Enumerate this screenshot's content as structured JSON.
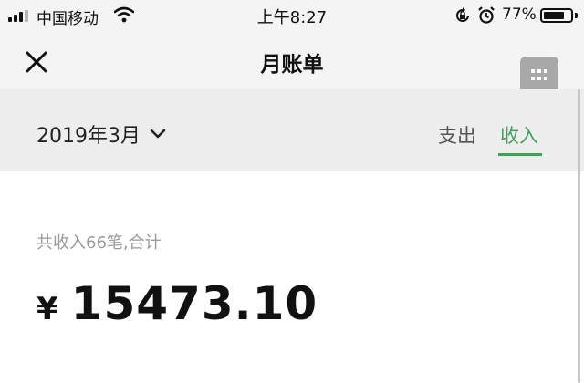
{
  "status_bar": {
    "carrier": "中国移动",
    "time": "上午8:27",
    "battery_percent": "77%",
    "battery_level": 0.77,
    "signal_bars_filled": 3,
    "signal_bars_total": 4
  },
  "nav": {
    "title": "月账单",
    "close_icon": "close-icon",
    "menu_icon": "grid-menu-icon"
  },
  "filter": {
    "month": "2019年3月",
    "tabs": [
      {
        "label": "支出",
        "active": false
      },
      {
        "label": "收入",
        "active": true
      }
    ],
    "accent_color": "#43a05c"
  },
  "summary": {
    "caption": "共收入66笔,合计",
    "currency": "¥",
    "amount": "15473.10"
  }
}
